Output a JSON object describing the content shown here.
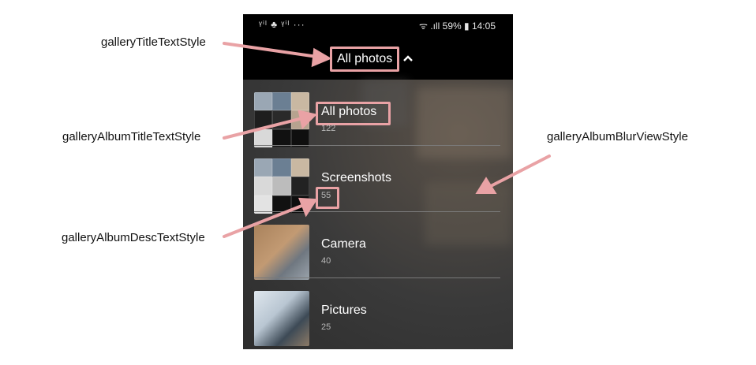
{
  "callouts": {
    "title_style": "galleryTitleTextStyle",
    "album_title_style": "galleryAlbumTitleTextStyle",
    "album_desc_style": "galleryAlbumDescTextStyle",
    "album_blur_style": "galleryAlbumBlurViewStyle"
  },
  "status_bar": {
    "left_icons": "ᵞⁱˡ ♣ ᵞⁱˡ ···",
    "right": "ᯤ .ıll 59% ▮ 14:05"
  },
  "header": {
    "title": "All photos",
    "chevron": "^"
  },
  "albums": [
    {
      "name": "All photos",
      "count": "122"
    },
    {
      "name": "Screenshots",
      "count": "55"
    },
    {
      "name": "Camera",
      "count": "40"
    },
    {
      "name": "Pictures",
      "count": "25"
    }
  ],
  "colors": {
    "highlight": "#e9a2a5",
    "arrow": "#e9a2a5",
    "phone_bg": "#2b2b2b"
  }
}
